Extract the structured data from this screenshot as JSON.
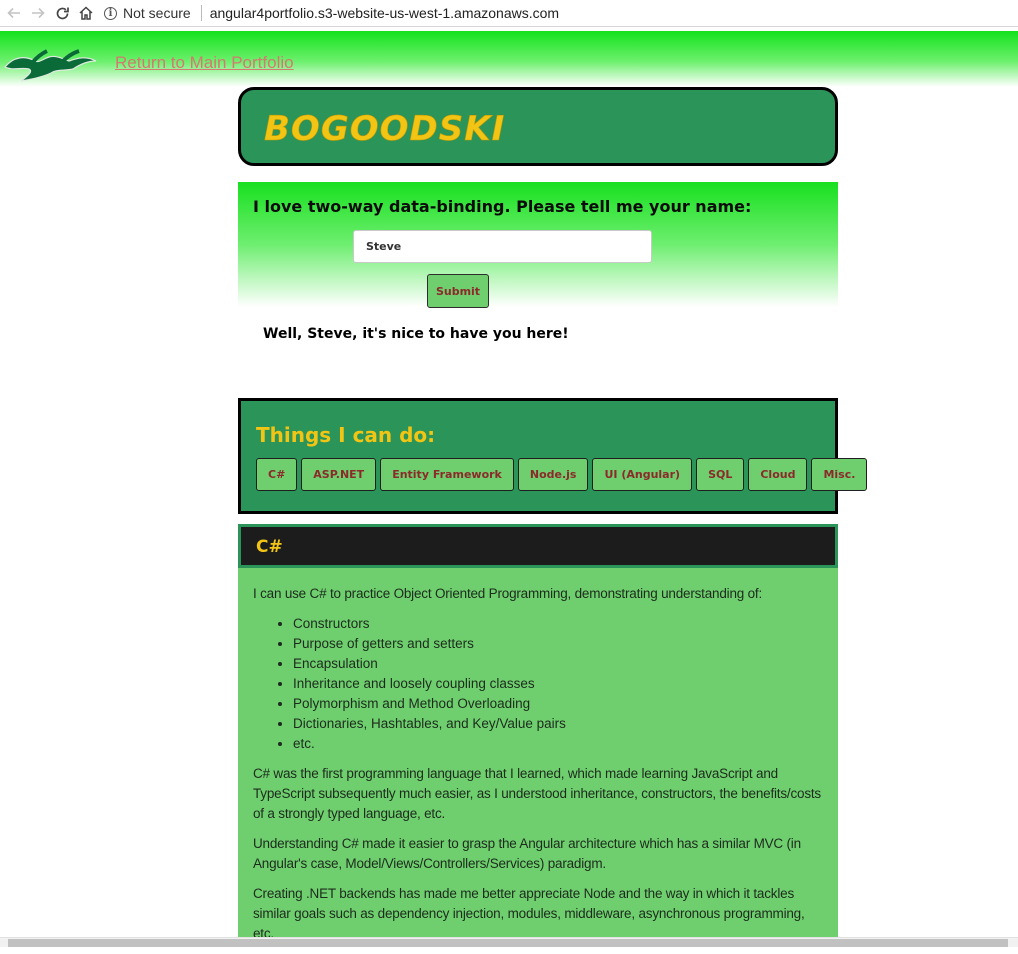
{
  "browser": {
    "security_label": "Not secure",
    "url": "angular4portfolio.s3-website-us-west-1.amazonaws.com"
  },
  "banner": {
    "return_link": "Return to Main Portfolio"
  },
  "header": {
    "title": "BOGOODSKI"
  },
  "name_form": {
    "prompt": "I love two-way data-binding. Please tell me your name:",
    "input_value": "Steve",
    "submit_label": "Submit",
    "greeting": "Well, Steve, it's nice to have you here!"
  },
  "skills": {
    "title": "Things I can do:",
    "buttons": [
      "C#",
      "ASP.NET",
      "Entity Framework",
      "Node.js",
      "UI (Angular)",
      "SQL",
      "Cloud",
      "Misc."
    ]
  },
  "panel": {
    "title": "C#",
    "intro": "I can use C# to practice Object Oriented Programming, demonstrating understanding of:",
    "list": [
      "Constructors",
      "Purpose of getters and setters",
      "Encapsulation",
      "Inheritance and loosely coupling classes",
      "Polymorphism and Method Overloading",
      "Dictionaries, Hashtables, and Key/Value pairs",
      "etc."
    ],
    "paragraphs": [
      "C# was the first programming language that I learned, which made learning JavaScript and TypeScript subsequently much easier, as I understood inheritance, constructors, the benefits/costs of a strongly typed language, etc.",
      "Understanding C# made it easier to grasp the Angular architecture which has a similar MVC (in Angular's case, Model/Views/Controllers/Services) paradigm.",
      "Creating .NET backends has made me better appreciate Node and the way in which it tackles similar goals such as dependency injection, modules, middleware, asynchronous programming, etc."
    ]
  },
  "colors": {
    "brand_green": "#2a9459",
    "accent_gold": "#f2c515",
    "button_green": "#6fcf6f",
    "button_text": "#8b2a2a",
    "link": "#d47a6f"
  }
}
